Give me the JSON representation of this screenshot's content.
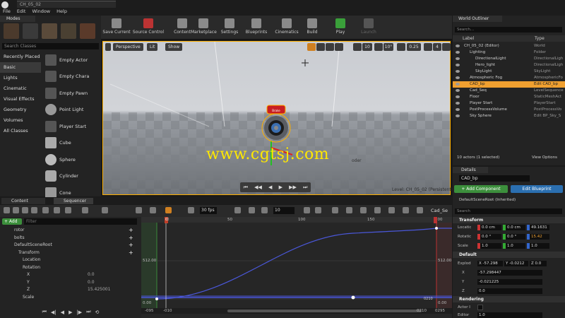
{
  "window": {
    "doc_tab": "CH_05_02"
  },
  "menu": [
    "File",
    "Edit",
    "Window",
    "Help"
  ],
  "modes": {
    "tab": "Modes",
    "search_placeholder": "Search Classes",
    "categories": [
      "Recently Placed",
      "Basic",
      "Lights",
      "Cinematic",
      "Visual Effects",
      "Geometry",
      "Volumes",
      "All Classes"
    ],
    "selected_category": "Basic",
    "placeables": [
      "Empty Actor",
      "Empty Chara",
      "Empty Pawn",
      "Point Light",
      "Player Start",
      "Cube",
      "Sphere",
      "Cylinder",
      "Cone"
    ]
  },
  "toolbar": {
    "buttons": [
      "Save Current",
      "Source Control",
      "Content",
      "Marketplace",
      "Settings",
      "Blueprints",
      "Cinematics",
      "Build",
      "Play",
      "Launch"
    ]
  },
  "viewport": {
    "perspective": "Perspective",
    "lit": "Lit",
    "show": "Show",
    "grid_snap": "10",
    "rot_snap": "10°",
    "scale_snap": "0.25",
    "camera_speed": "4",
    "level_label": "Level:  CH_05_02 (Persistent)",
    "watermark": "www.cgtsj.com",
    "stray_label": "oder",
    "disc_label": "Brake"
  },
  "outliner": {
    "tab": "World Outliner",
    "search_placeholder": "Search...",
    "col_label": "Label",
    "col_type": "Type",
    "rows": [
      {
        "label": "CH_05_02 (Editor)",
        "type": "World",
        "indent": 0
      },
      {
        "label": "Lighting",
        "type": "Folder",
        "indent": 1
      },
      {
        "label": "DirectionalLight",
        "type": "DirectionalLigh",
        "indent": 2
      },
      {
        "label": "Hero_light",
        "type": "DirectionalLigh",
        "indent": 2
      },
      {
        "label": "SkyLight",
        "type": "SkyLight",
        "indent": 2
      },
      {
        "label": "Atmospheric Fog",
        "type": "AtmosphericFo",
        "indent": 1
      },
      {
        "label": "CAD_bp",
        "type": "Edit CAD_bp",
        "indent": 1,
        "selected": true
      },
      {
        "label": "Cad_Seq",
        "type": "LevelSequence",
        "indent": 1
      },
      {
        "label": "Floor",
        "type": "StaticMeshAct",
        "indent": 1
      },
      {
        "label": "Player Start",
        "type": "PlayerStart",
        "indent": 1
      },
      {
        "label": "PostProcessVolume",
        "type": "PostProcessVo",
        "indent": 1
      },
      {
        "label": "Sky Sphere",
        "type": "Edit BP_Sky_S",
        "indent": 1
      }
    ],
    "footer_count": "10 actors (1 selected)",
    "view_options": "View Options"
  },
  "details": {
    "tab": "Details",
    "name": "CAD_bp",
    "add_component": "+ Add Component",
    "edit_blueprint": "Edit Blueprint",
    "scene_root": "DefaultSceneRoot (Inherited)",
    "search_placeholder": "Search",
    "transform_header": "Transform",
    "location_label": "Locatic",
    "location": [
      "0.0 cm",
      "0.0 cm",
      "49.1631"
    ],
    "rotation_label": "Rotatic",
    "rotation": [
      "0.0 °",
      "0.0 °",
      "15.42"
    ],
    "scale_label": "Scale",
    "scale": [
      "1.0",
      "1.0",
      "1.0"
    ],
    "default_header": "Default",
    "explode_label": "Explod",
    "explode": [
      "X -57.298",
      "Y -0.0212",
      "Z 0.0"
    ],
    "x_label": "X",
    "x_val": "-57.298447",
    "y_label": "Y",
    "y_val": "-0.021225",
    "z_label": "Z",
    "z_val": "0.0",
    "rendering_header": "Rendering",
    "actor_hidden_label": "Actor I",
    "editor_label": "Editor",
    "editor_val": "1.0"
  },
  "sequencer": {
    "tab_content": "Content Browser",
    "tab_sequencer": "Sequencer",
    "fps": "30 fps",
    "snap": "10",
    "seq_name": "Cad_Se",
    "add_track": "+ Add",
    "filter_placeholder": "Filter",
    "tracks": [
      {
        "label": "rotor",
        "indent": 1,
        "plus": true
      },
      {
        "label": "bolts",
        "indent": 1,
        "plus": true
      },
      {
        "label": "DefaultSceneRoot",
        "indent": 1,
        "plus": true
      },
      {
        "label": "Transform",
        "indent": 2,
        "plus": true
      },
      {
        "label": "Location",
        "indent": 3
      },
      {
        "label": "Rotation",
        "indent": 3
      },
      {
        "label": "X",
        "indent": 4,
        "value": "0.0"
      },
      {
        "label": "Y",
        "indent": 4,
        "value": "0.0"
      },
      {
        "label": "Z",
        "indent": 4,
        "value": "15.425001"
      },
      {
        "label": "Scale",
        "indent": 3
      }
    ],
    "ruler_ticks": [
      "0",
      "50",
      "100",
      "150",
      "200"
    ],
    "value_labels": [
      "512.00",
      "0.00"
    ],
    "bottom_labels": [
      "-095",
      "-010",
      "0210",
      "0295"
    ],
    "playhead_frame": "0",
    "end_frame": "0210"
  },
  "colors": {
    "accent": "#ffb000",
    "selection": "#f0a030",
    "add_green": "#3c8f3c",
    "blueprint_blue": "#2b6fb0",
    "curve_blue": "#4a57d9",
    "watermark": "#ffe800"
  }
}
